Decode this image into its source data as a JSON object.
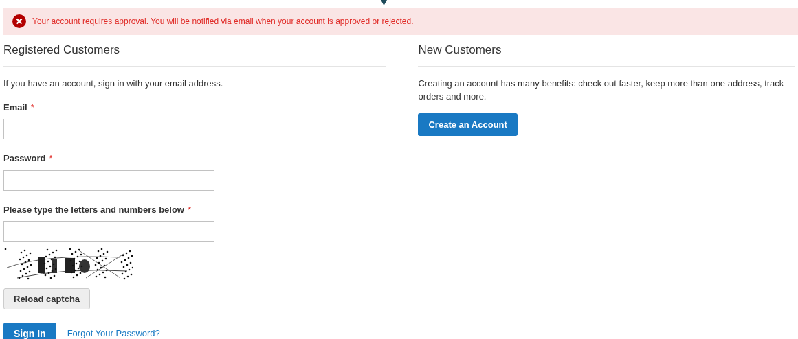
{
  "alert": {
    "kind": "error",
    "message": "Your account requires approval. You will be notified via email when your account is approved or rejected."
  },
  "registered": {
    "title": "Registered Customers",
    "intro": "If you have an account, sign in with your email address.",
    "fields": [
      {
        "label": "Email",
        "required": true,
        "kind": "text"
      },
      {
        "label": "Password",
        "required": true,
        "kind": "text"
      },
      {
        "label": "Please type the letters and numbers below",
        "required": true,
        "kind": "captcha"
      }
    ],
    "required_mark": "*",
    "reload_button": "Reload captcha",
    "sign_in_button": "Sign In",
    "forgot_link": "Forgot Your Password?"
  },
  "new_customers": {
    "title": "New Customers",
    "intro": "Creating an account has many benefits: check out faster, keep more than one address, track orders and more.",
    "create_button": "Create an Account"
  }
}
